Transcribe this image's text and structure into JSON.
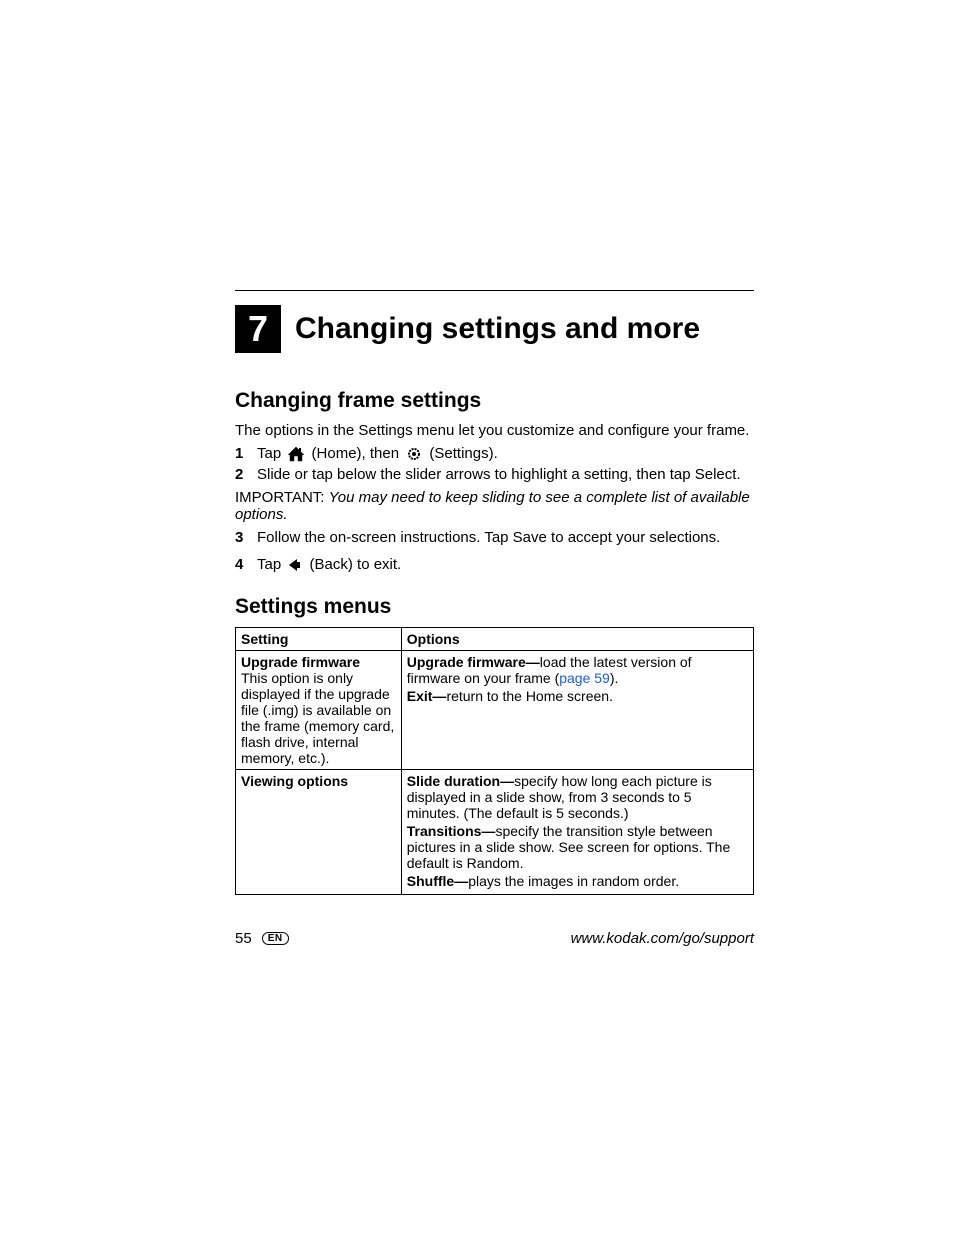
{
  "chapter": {
    "number": "7",
    "title": "Changing settings and more"
  },
  "section1": {
    "heading": "Changing frame settings",
    "intro": "The options in the Settings menu let you customize and configure your frame."
  },
  "steps": {
    "s1": {
      "n": "1",
      "pre": "Tap ",
      "mid": " (Home), then ",
      "post": " (Settings)."
    },
    "s2": {
      "n": "2",
      "text": "Slide or tap below the slider arrows to highlight a setting, then tap Select."
    },
    "important": {
      "label": "IMPORTANT: ",
      "text": "You may need to keep sliding to see a complete list of available options."
    },
    "s3": {
      "n": "3",
      "text": "Follow the on-screen instructions. Tap Save to accept your selections."
    },
    "s4": {
      "n": "4",
      "pre": "Tap ",
      "post": " (Back) to exit."
    }
  },
  "section2": {
    "heading": "Settings menus"
  },
  "table": {
    "head": {
      "c1": "Setting",
      "c2": "Options"
    },
    "row1": {
      "setting_title": "Upgrade firmware",
      "setting_desc": "This option is only displayed if the upgrade file (.img) is available on the frame (memory card, flash drive, internal memory, etc.).",
      "opt1_bold": "Upgrade firmware—",
      "opt1_rest": "load the latest version of firmware on your frame (",
      "opt1_link": "page 59",
      "opt1_tail": ").",
      "opt2_bold": "Exit—",
      "opt2_rest": "return to the Home screen."
    },
    "row2": {
      "setting_title": "Viewing options",
      "opt1_bold": "Slide duration—",
      "opt1_rest": "specify how long each picture is displayed in a slide show, from 3 seconds to 5 minutes. (The default is 5 seconds.)",
      "opt2_bold": "Transitions—",
      "opt2_rest": "specify the transition style between pictures in a slide show. See screen for options. The default is Random.",
      "opt3_bold": "Shuffle—",
      "opt3_rest": "plays the images in random order."
    }
  },
  "footer": {
    "page": "55",
    "lang": "EN",
    "url": "www.kodak.com/go/support"
  }
}
